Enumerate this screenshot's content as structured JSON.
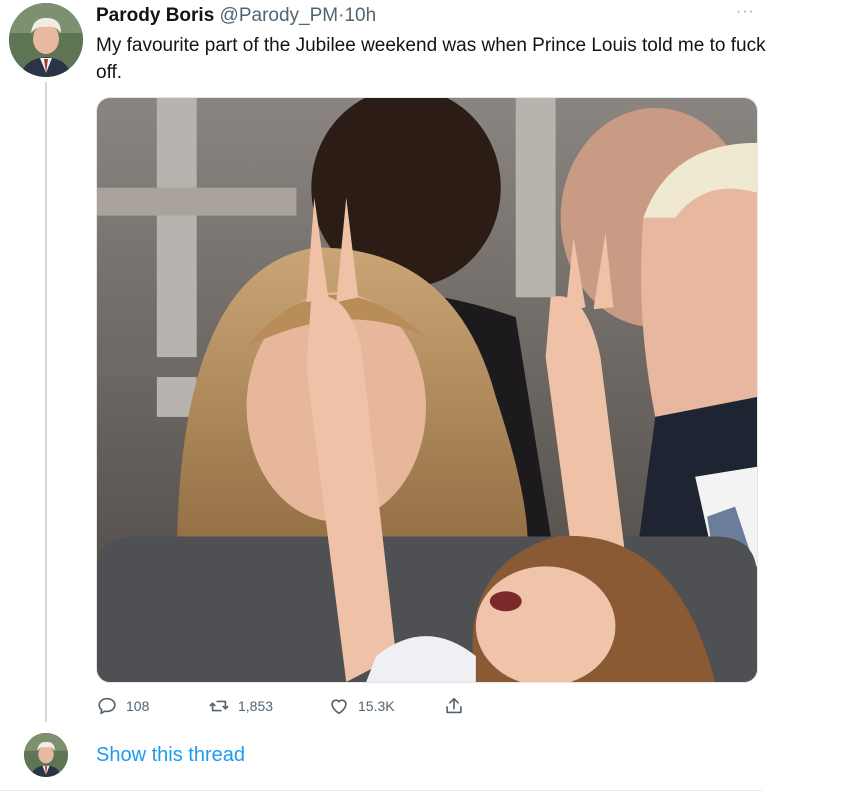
{
  "tweet": {
    "author_name": "Parody Boris",
    "handle": "@Parody_PM",
    "separator": "·",
    "time": "10h",
    "more_label": "···",
    "text": "My favourite part of the Jubilee weekend was when Prince Louis told me to fuck off.",
    "media_icon": "photo"
  },
  "actions": {
    "replies": "108",
    "retweets": "1,853",
    "likes": "15.3K",
    "reply_icon": "reply-icon",
    "retweet_icon": "retweet-icon",
    "like_icon": "heart-icon",
    "share_icon": "share-icon"
  },
  "thread": {
    "show_label": "Show this thread"
  },
  "colors": {
    "link": "#1d9bf0",
    "muted": "#536471",
    "thread_line": "#cfd9de"
  }
}
